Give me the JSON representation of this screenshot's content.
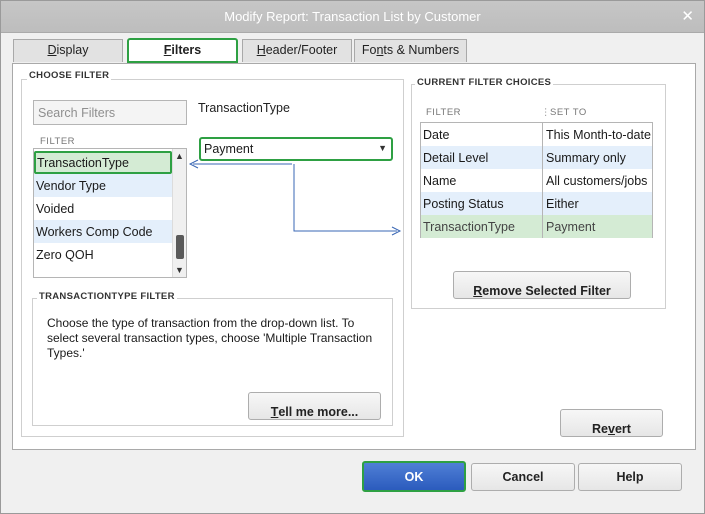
{
  "window": {
    "title": "Modify Report: Transaction List by Customer",
    "close_glyph": "✕"
  },
  "tabs": [
    {
      "label_u": "D",
      "label_rest": "isplay"
    },
    {
      "label_u": "F",
      "label_rest": "ilters"
    },
    {
      "label_u": "H",
      "label_rest": "eader/Footer"
    },
    {
      "label_pre": "Fo",
      "label_u": "n",
      "label_rest": "ts & Numbers"
    }
  ],
  "choose_filter": {
    "heading": "CHOOSE FILTER",
    "search_placeholder": "Search Filters",
    "selected_field": "TransactionType",
    "list_header": "FILTER",
    "items": [
      "TransactionType",
      "Vendor Type",
      "Voided",
      "Workers Comp Code",
      "Zero QOH"
    ],
    "dropdown_value": "Payment"
  },
  "filter_help": {
    "heading": "TRANSACTIONTYPE FILTER",
    "description": "Choose the type of transaction from the drop-down list. To select several transaction types, choose 'Multiple Transaction Types.'",
    "tell_me_u": "T",
    "tell_me_rest": "ell me more..."
  },
  "current_filters": {
    "heading": "CURRENT FILTER CHOICES",
    "col_filter": "FILTER",
    "col_set_to": "SET TO",
    "rows": [
      {
        "filter": "Date",
        "set_to": "This Month-to-date"
      },
      {
        "filter": "Detail Level",
        "set_to": "Summary only"
      },
      {
        "filter": "Name",
        "set_to": "All customers/jobs"
      },
      {
        "filter": "Posting Status",
        "set_to": "Either"
      },
      {
        "filter": "TransactionType",
        "set_to": "Payment"
      }
    ],
    "remove_u": "R",
    "remove_rest": "emove Selected Filter"
  },
  "buttons": {
    "revert_pre": "Re",
    "revert_u": "v",
    "revert_rest": "ert",
    "ok": "OK",
    "cancel": "Cancel",
    "help": "Help"
  },
  "colors": {
    "highlight_green": "#2ea043",
    "connector_blue": "#3a67b5",
    "ok_blue": "#2b5bbd"
  }
}
